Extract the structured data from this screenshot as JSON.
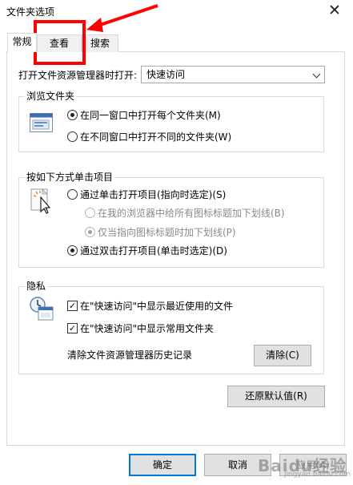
{
  "window": {
    "title": "文件夹选项",
    "close_symbol": "✕"
  },
  "tabs": [
    {
      "label": "常规",
      "active": true
    },
    {
      "label": "查看",
      "active": false
    },
    {
      "label": "搜索",
      "active": false
    }
  ],
  "open_explorer": {
    "label": "打开文件资源管理器时打开:",
    "selected": "快速访问"
  },
  "browse_folders": {
    "title": "浏览文件夹",
    "options": [
      {
        "label": "在同一窗口中打开每个文件夹(M)",
        "checked": true
      },
      {
        "label": "在不同窗口中打开不同的文件夹(W)",
        "checked": false
      }
    ]
  },
  "click_items": {
    "title": "按如下方式单击项目",
    "single_click": {
      "label": "通过单击打开项目(指向时选定)(S)",
      "checked": false
    },
    "underline_all": {
      "label": "在我的浏览器中给所有图标标题加下划线(B)",
      "checked": false,
      "disabled": true
    },
    "underline_point": {
      "label": "仅当指向图标标题时加下划线(P)",
      "checked": true,
      "disabled": true
    },
    "double_click": {
      "label": "通过双击打开项目(单击时选定)(D)",
      "checked": true
    }
  },
  "privacy": {
    "title": "隐私",
    "show_recent": {
      "label": "在\"快速访问\"中显示最近使用的文件",
      "checked": true
    },
    "show_frequent": {
      "label": "在\"快速访问\"中显示常用文件夹",
      "checked": true
    },
    "clear_label": "清除文件资源管理器历史记录",
    "clear_button": "清除(C)"
  },
  "restore_defaults": "还原默认值(R)",
  "footer": {
    "ok": "确定",
    "cancel": "取消",
    "apply": "应用(A)"
  },
  "annotation": {
    "color": "#ff0000"
  },
  "watermark": {
    "logo": "Baidu经验",
    "url": "jingyan.baidu.com"
  }
}
